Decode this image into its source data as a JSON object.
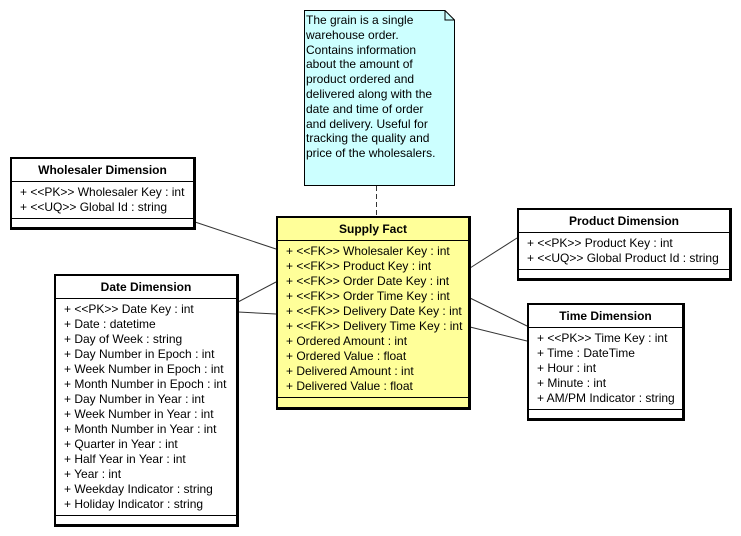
{
  "note": {
    "lines": [
      "The grain is a single",
      "warehouse order.",
      "Contains information",
      "about the amount of",
      "product ordered and",
      "delivered along with the",
      "date and time of order",
      "and delivery. Useful for",
      "tracking the quality and",
      "price of the wholesalers."
    ],
    "color": "#ccffff"
  },
  "fact": {
    "title": "Supply Fact",
    "color": "#ffff99",
    "attributes": [
      "+ <<FK>> Wholesaler Key : int",
      "+ <<FK>> Product Key : int",
      "+ <<FK>> Order Date Key : int",
      "+ <<FK>> Order Time Key : int",
      "+ <<FK>> Delivery Date Key : int",
      "+ <<FK>> Delivery Time Key : int",
      "+ Ordered Amount : int",
      "+ Ordered Value : float",
      "+ Delivered Amount : int",
      "+ Delivered Value : float"
    ]
  },
  "wholesaler": {
    "title": "Wholesaler Dimension",
    "attributes": [
      "+ <<PK>> Wholesaler Key : int",
      "+ <<UQ>> Global Id : string"
    ]
  },
  "product": {
    "title": "Product Dimension",
    "attributes": [
      "+ <<PK>> Product Key : int",
      "+ <<UQ>> Global Product Id : string"
    ]
  },
  "time": {
    "title": "Time Dimension",
    "attributes": [
      "+ <<PK>> Time Key : int",
      "+ Time : DateTime",
      "+ Hour : int",
      "+ Minute : int",
      "+ AM/PM Indicator : string"
    ]
  },
  "date": {
    "title": "Date Dimension",
    "attributes": [
      "+ <<PK>> Date Key : int",
      "+ Date : datetime",
      "+ Day of Week : string",
      "+ Day Number in Epoch : int",
      "+ Week Number in Epoch : int",
      "+ Month Number in Epoch : int",
      "+ Day Number in Year : int",
      "+ Week Number in Year : int",
      "+ Month Number in Year : int",
      "+ Quarter in Year : int",
      "+ Half Year in Year : int",
      "+ Year : int",
      "+ Weekday Indicator : string",
      "+ Holiday Indicator : string"
    ]
  }
}
